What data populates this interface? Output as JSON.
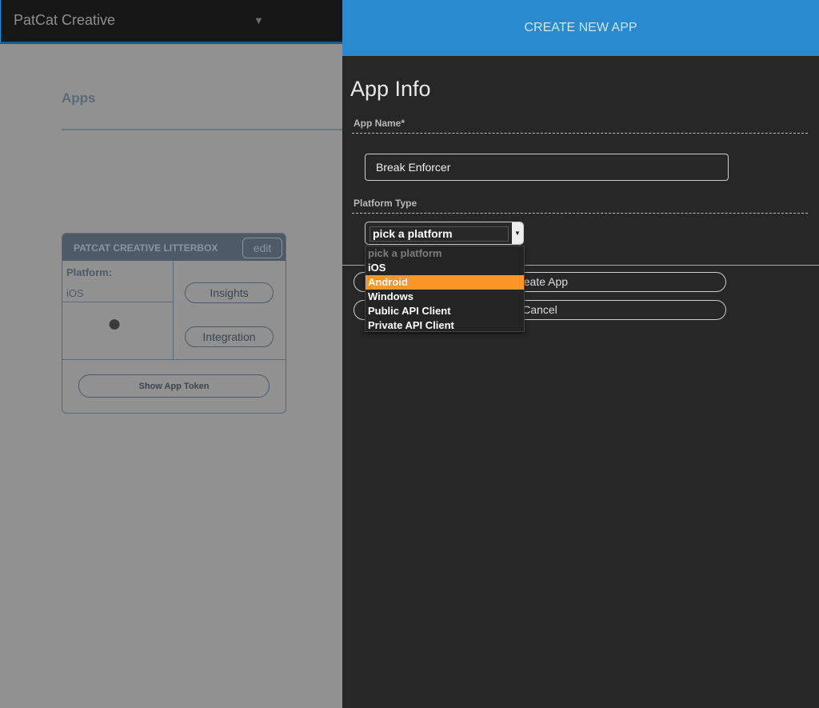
{
  "header": {
    "org": "PatCat Creative"
  },
  "main": {
    "title": "Apps"
  },
  "card": {
    "title": "PATCAT CREATIVE LITTERBOX",
    "edit": "edit",
    "platform_label": "Platform:",
    "platform_value": "iOS",
    "insights": "Insights",
    "integration": "Integration",
    "token": "Show App Token"
  },
  "panel": {
    "title": "CREATE NEW APP",
    "section": "App Info",
    "app_name_label": "App Name*",
    "app_name_value": "Break Enforcer",
    "platform_label": "Platform Type",
    "select_value": "pick a platform",
    "create": "Create App",
    "cancel": "Cancel",
    "options": [
      "pick a platform",
      "iOS",
      "Android",
      "Windows",
      "Public API Client",
      "Private API Client"
    ],
    "highlighted": "Android"
  },
  "colors": {
    "accent": "#2a8ad0",
    "highlight": "#fa9526"
  }
}
